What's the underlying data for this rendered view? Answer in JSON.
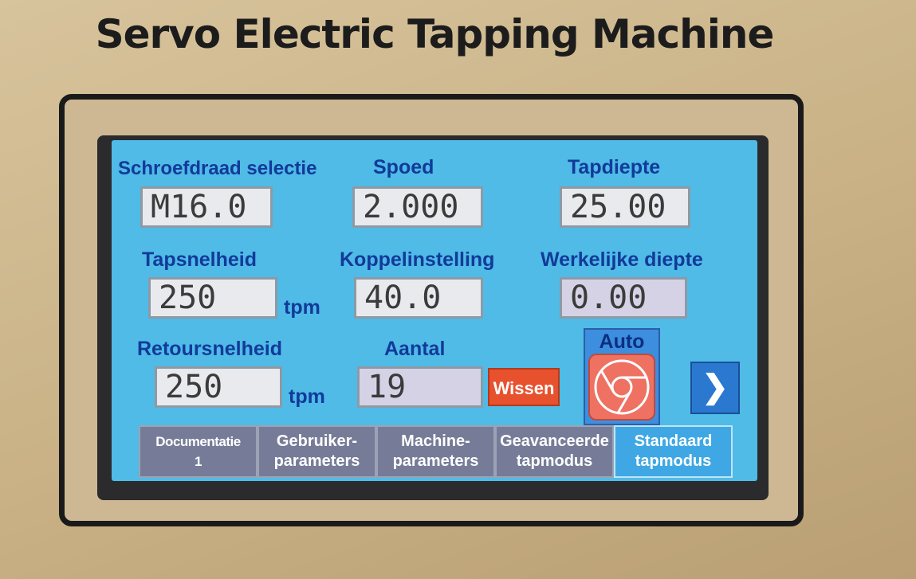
{
  "machine_title": "Servo Electric Tapping Machine",
  "fields": {
    "thread_selection": {
      "label": "Schroefdraad selectie",
      "value": "M16.0"
    },
    "pitch": {
      "label": "Spoed",
      "value": "2.000"
    },
    "tap_depth": {
      "label": "Tapdiepte",
      "value": "25.00"
    },
    "tap_speed": {
      "label": "Tapsnelheid",
      "value": "250",
      "unit": "tpm"
    },
    "torque_setting": {
      "label": "Koppelinstelling",
      "value": "40.0"
    },
    "actual_depth": {
      "label": "Werkelijke diepte",
      "value": "0.00"
    },
    "return_speed": {
      "label": "Retoursnelheid",
      "value": "250",
      "unit": "tpm"
    },
    "count": {
      "label": "Aantal",
      "value": "19"
    }
  },
  "buttons": {
    "clear": "Wissen",
    "auto_label": "Auto",
    "next_icon": "chevron-right-icon",
    "next_glyph": "❯",
    "auto_icon": "chrome-logo-icon"
  },
  "tabs": [
    {
      "label": "Documentatie\n1",
      "active": false
    },
    {
      "label": "Gebruiker-\nparameters",
      "active": false
    },
    {
      "label": "Machine-\nparameters",
      "active": false
    },
    {
      "label": "Geavanceerde\ntapmodus",
      "active": false
    },
    {
      "label": "Standaard\ntapmodus",
      "active": true
    }
  ],
  "colors": {
    "screen_bg": "#4fbbe6",
    "label_text": "#123a9a",
    "clear_button": "#e8512e",
    "auto_button": "#ee7162",
    "tab_inactive": "#767c98",
    "tab_active": "#3fa8e4"
  }
}
